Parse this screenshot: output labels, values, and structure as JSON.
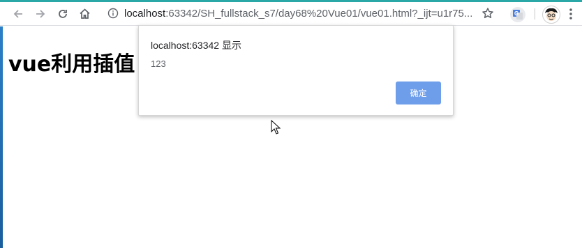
{
  "browser": {
    "url_host": "localhost",
    "url_rest": ":63342/SH_fullstack_s7/day68%20Vue01/vue01.html?_ijt=u1r75...",
    "icons": {
      "back": "back-arrow-icon",
      "forward": "forward-arrow-icon",
      "reload": "reload-icon",
      "home": "home-icon",
      "info": "info-icon",
      "bookmark": "star-icon",
      "translate": "google-translate-icon",
      "profile": "avatar",
      "menu": "menu-dots-icon"
    },
    "accent_color": "#2aa7a7"
  },
  "page": {
    "heading": "vue利用插值"
  },
  "dialog": {
    "title": "localhost:63342 显示",
    "message": "123",
    "ok_label": "确定",
    "button_color": "#6e9eea"
  }
}
